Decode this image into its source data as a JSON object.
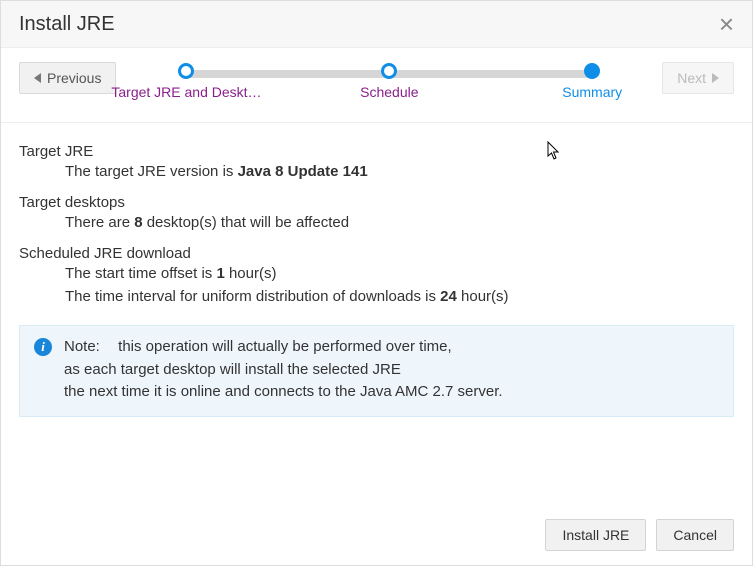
{
  "dialog": {
    "title": "Install JRE"
  },
  "nav": {
    "previous_label": "Previous",
    "next_label": "Next"
  },
  "steps": {
    "step1_label": "Target JRE and Deskt…",
    "step2_label": "Schedule",
    "step3_label": "Summary"
  },
  "summary": {
    "target_jre_heading": "Target JRE",
    "target_jre_prefix": "The target JRE version is ",
    "target_jre_value": "Java 8 Update 141",
    "target_desktops_heading": "Target desktops",
    "target_desktops_prefix": "There are ",
    "target_desktops_count": "8",
    "target_desktops_suffix": " desktop(s) that will be affected",
    "scheduled_heading": "Scheduled JRE download",
    "scheduled_start_prefix": "The start time offset is ",
    "scheduled_start_value": "1",
    "scheduled_start_suffix": " hour(s)",
    "scheduled_interval_prefix": "The time interval for uniform distribution of downloads is ",
    "scheduled_interval_value": "24",
    "scheduled_interval_suffix": " hour(s)"
  },
  "note": {
    "label": "Note:",
    "line1": "this operation will actually be performed over time,",
    "line2": "as each target desktop will install the selected JRE",
    "line3": "the next time it is online and connects to the Java AMC 2.7 server."
  },
  "footer": {
    "install_label": "Install JRE",
    "cancel_label": "Cancel"
  }
}
